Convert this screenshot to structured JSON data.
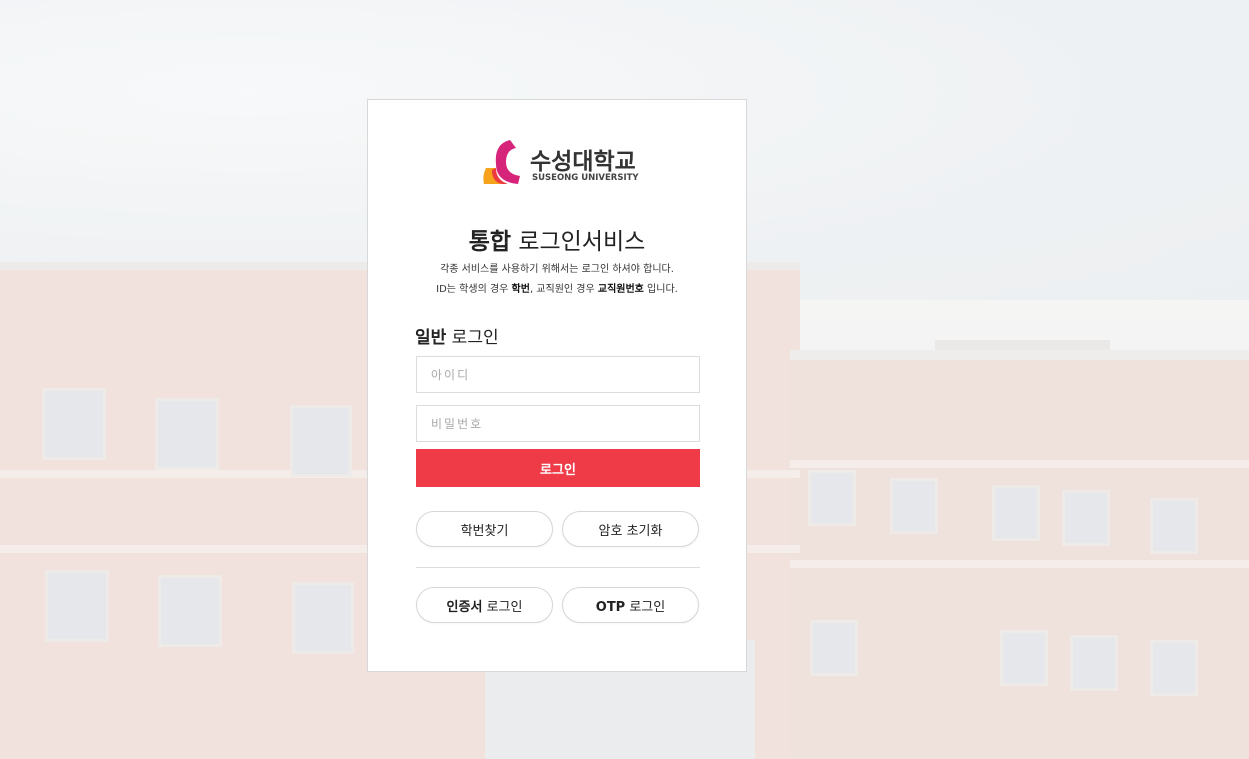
{
  "brand": {
    "name_ko": "수성대학교",
    "name_en": "SUSEONG UNIVERSITY",
    "colors": {
      "accent": "#ee3b47",
      "logo_orange": "#f6a21c",
      "logo_magenta": "#d6247a"
    }
  },
  "header": {
    "title_bold": "통합",
    "title_rest": " 로그인서비스",
    "desc_line1": "각종 서비스를 사용하기 위해서는 로그인 하셔야 합니다.",
    "desc_line2_a": "ID는 학생의 경우 ",
    "desc_line2_b": "학번",
    "desc_line2_c": ", 교직원인 경우 ",
    "desc_line2_d": "교직원번호",
    "desc_line2_e": " 입니다."
  },
  "login": {
    "section_bold": "일반",
    "section_rest": " 로그인",
    "id_placeholder": "아이디",
    "pw_placeholder": "비밀번호",
    "submit_label": "로그인"
  },
  "links": {
    "find_id": "학번찾기",
    "reset_pw": "암호 초기화",
    "cert_bold": "인증서",
    "cert_rest": " 로그인",
    "otp_bold": "OTP",
    "otp_rest": " 로그인"
  }
}
